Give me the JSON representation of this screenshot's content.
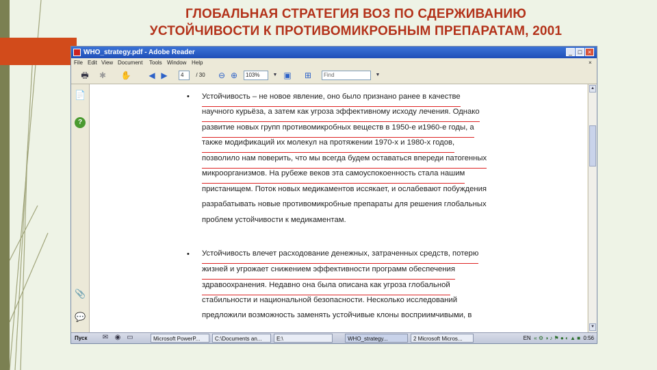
{
  "slide": {
    "title_line1": "ГЛОБАЛЬНАЯ СТРАТЕГИЯ ВОЗ ПО СДЕРЖИВАНИЮ",
    "title_line2": "УСТОЙЧИВОСТИ К ПРОТИВОМИКРОБНЫМ ПРЕПАРАТАМ, 2001",
    "accent_color": "#b3321a",
    "tab_color": "#d24b1b"
  },
  "window": {
    "title": "WHO_strategy.pdf - Adobe Reader",
    "controls": {
      "minimize": "_",
      "maximize": "□",
      "close": "×"
    }
  },
  "menubar": [
    "File",
    "Edit",
    "View",
    "Document",
    "Tools",
    "Window",
    "Help"
  ],
  "toolbar": {
    "page_current": "4",
    "page_total": "/ 30",
    "zoom": "103%",
    "find_placeholder": "Find"
  },
  "document": {
    "paragraph1": [
      "Устойчивость – не новое явление, оно было признано ранее в качестве",
      "научного курьёза, а затем как угроза эффективному исходу лечения. Однако",
      "развитие новых групп противомикробных веществ в 1950-е и1960-е годы, а",
      "также модификаций их молекул на протяжении 1970-х и 1980-х годов,",
      "позволило нам поверить, что мы всегда будем оставаться впереди патогенных",
      "микроорганизмов. На рубеже веков эта самоуспокоенность стала нашим",
      "пристанищем. Поток новых медикаментов иссякает, и ослабевают побуждения",
      "разрабатывать новые противомикробные препараты для решения глобальных",
      "проблем устойчивости к медикаментам."
    ],
    "paragraph2": [
      "Устойчивость влечет расходование денежных, затраченных средств,  потерю",
      "жизней и угрожает снижением эффективности программ обеспечения",
      "здравоохранения. Недавно она была описана как угроза глобальной",
      "стабильности и национальной безопасности. Несколько исследований",
      "предложили возможность заменять устойчивые клоны  восприимчивыми, в"
    ],
    "bullet": "•",
    "underline_color": "#d22"
  },
  "taskbar": {
    "start": "Пуск",
    "items": [
      "Microsoft PowerP...",
      "C:\\Documents an...",
      "E:\\",
      "WHO_strategy...",
      "2 Microsoft Micros..."
    ],
    "lang": "EN",
    "clock": "0:56"
  }
}
